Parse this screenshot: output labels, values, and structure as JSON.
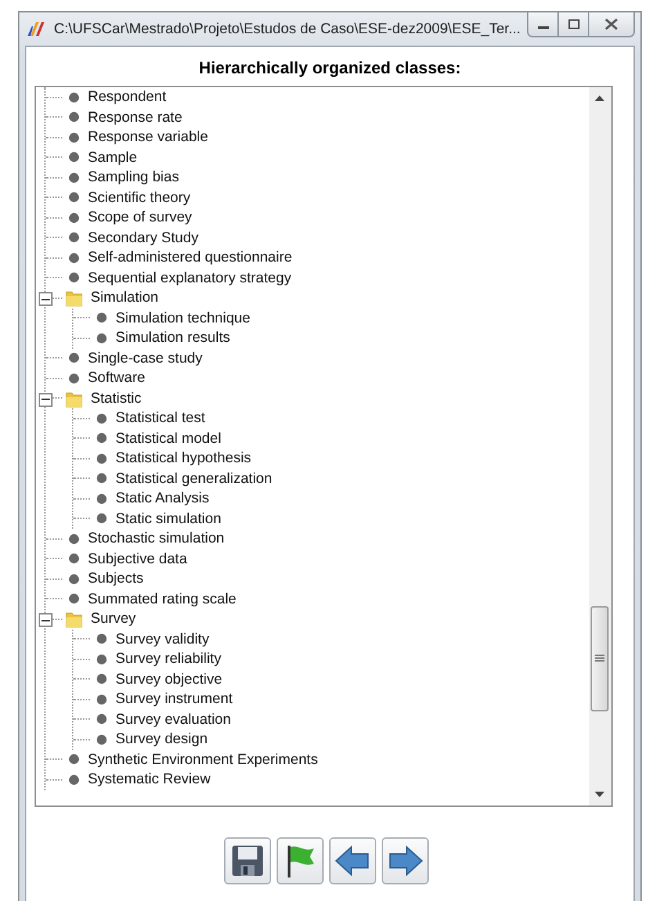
{
  "window": {
    "title": "C:\\UFSCar\\Mestrado\\Projeto\\Estudos de Caso\\ESE-dez2009\\ESE_Ter..."
  },
  "heading": "Hierarchically organized classes:",
  "tree": [
    {
      "label": "Respondent"
    },
    {
      "label": "Response rate"
    },
    {
      "label": "Response variable"
    },
    {
      "label": "Sample"
    },
    {
      "label": "Sampling bias"
    },
    {
      "label": "Scientific theory"
    },
    {
      "label": "Scope of survey"
    },
    {
      "label": "Secondary Study"
    },
    {
      "label": "Self-administered questionnaire"
    },
    {
      "label": "Sequential explanatory strategy"
    },
    {
      "label": "Simulation",
      "expanded": true,
      "children": [
        {
          "label": "Simulation technique"
        },
        {
          "label": "Simulation results"
        }
      ]
    },
    {
      "label": "Single-case study"
    },
    {
      "label": "Software"
    },
    {
      "label": "Statistic",
      "expanded": true,
      "children": [
        {
          "label": "Statistical test"
        },
        {
          "label": "Statistical model"
        },
        {
          "label": "Statistical hypothesis"
        },
        {
          "label": "Statistical generalization"
        },
        {
          "label": "Static Analysis"
        },
        {
          "label": "Static simulation"
        }
      ]
    },
    {
      "label": "Stochastic simulation"
    },
    {
      "label": "Subjective data"
    },
    {
      "label": "Subjects"
    },
    {
      "label": "Summated rating scale"
    },
    {
      "label": "Survey",
      "expanded": true,
      "children": [
        {
          "label": "Survey validity"
        },
        {
          "label": "Survey reliability"
        },
        {
          "label": "Survey objective"
        },
        {
          "label": "Survey instrument"
        },
        {
          "label": "Survey evaluation"
        },
        {
          "label": "Survey design"
        }
      ]
    },
    {
      "label": "Synthetic Environment Experiments"
    },
    {
      "label": "Systematic Review"
    }
  ],
  "toolbar": [
    {
      "kind": "save"
    },
    {
      "kind": "flag"
    },
    {
      "kind": "back"
    },
    {
      "kind": "forward"
    }
  ]
}
